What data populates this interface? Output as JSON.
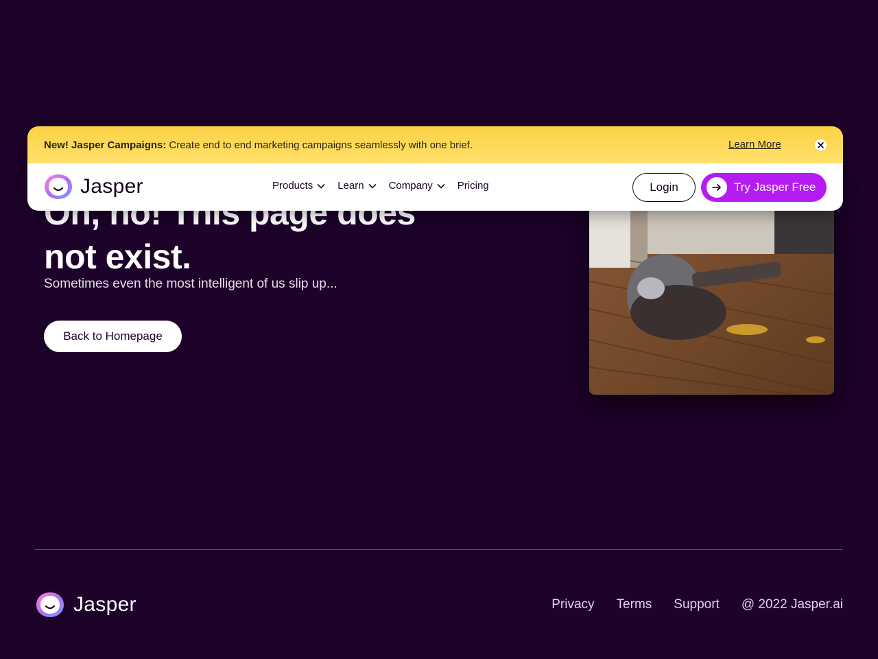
{
  "announcement": {
    "bold": "New! Jasper Campaigns:",
    "text": "Create end to end marketing campaigns seamlessly with one brief.",
    "learn_more": "Learn More",
    "close_icon": "close-icon"
  },
  "nav": {
    "brand": "Jasper",
    "items": [
      {
        "label": "Products",
        "dropdown": true
      },
      {
        "label": "Learn",
        "dropdown": true
      },
      {
        "label": "Company",
        "dropdown": true
      },
      {
        "label": "Pricing",
        "dropdown": false
      }
    ],
    "login": "Login",
    "cta": "Try Jasper Free"
  },
  "hero": {
    "title": "Oh, no! This page does not exist.",
    "subtitle": "Sometimes even the most intelligent of us slip up...",
    "button": "Back to Homepage"
  },
  "footer": {
    "brand": "Jasper",
    "links": [
      "Privacy",
      "Terms",
      "Support"
    ],
    "copyright": "@ 2022 Jasper.ai"
  },
  "colors": {
    "background": "#1d0229",
    "accent": "#b51cf2",
    "banner": "#fbd245"
  }
}
